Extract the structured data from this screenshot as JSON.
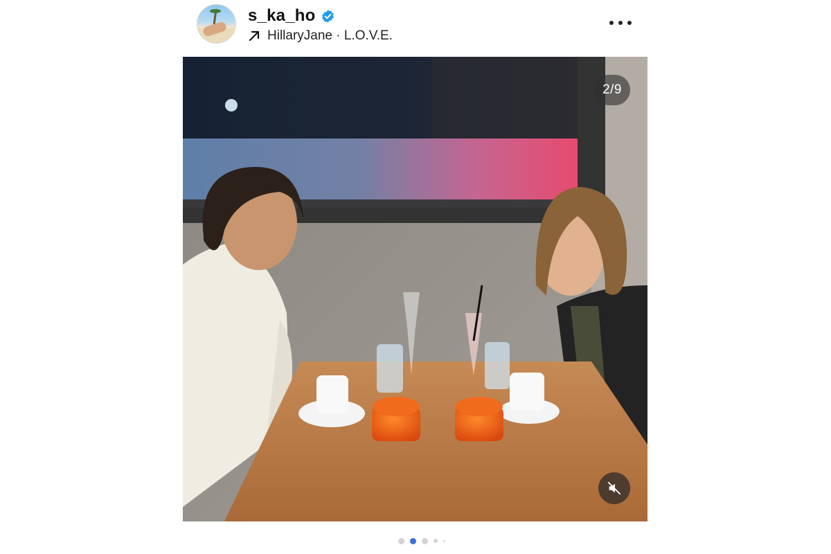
{
  "post": {
    "username": "s_ka_ho",
    "verified": true,
    "music": "HillaryJane · L.O.V.E.",
    "icons": {
      "verified": "verified-badge-icon",
      "music": "arrow-up-right-icon",
      "more": "more-horizontal-icon",
      "mute": "speaker-muted-icon"
    }
  },
  "media": {
    "counter": "2/9",
    "description_icon": "photo"
  },
  "carousel": {
    "total_dots_shown": 5,
    "active_index": 1
  },
  "colors": {
    "accent": "#3b6fe0",
    "verified": "#1d9bf0"
  }
}
